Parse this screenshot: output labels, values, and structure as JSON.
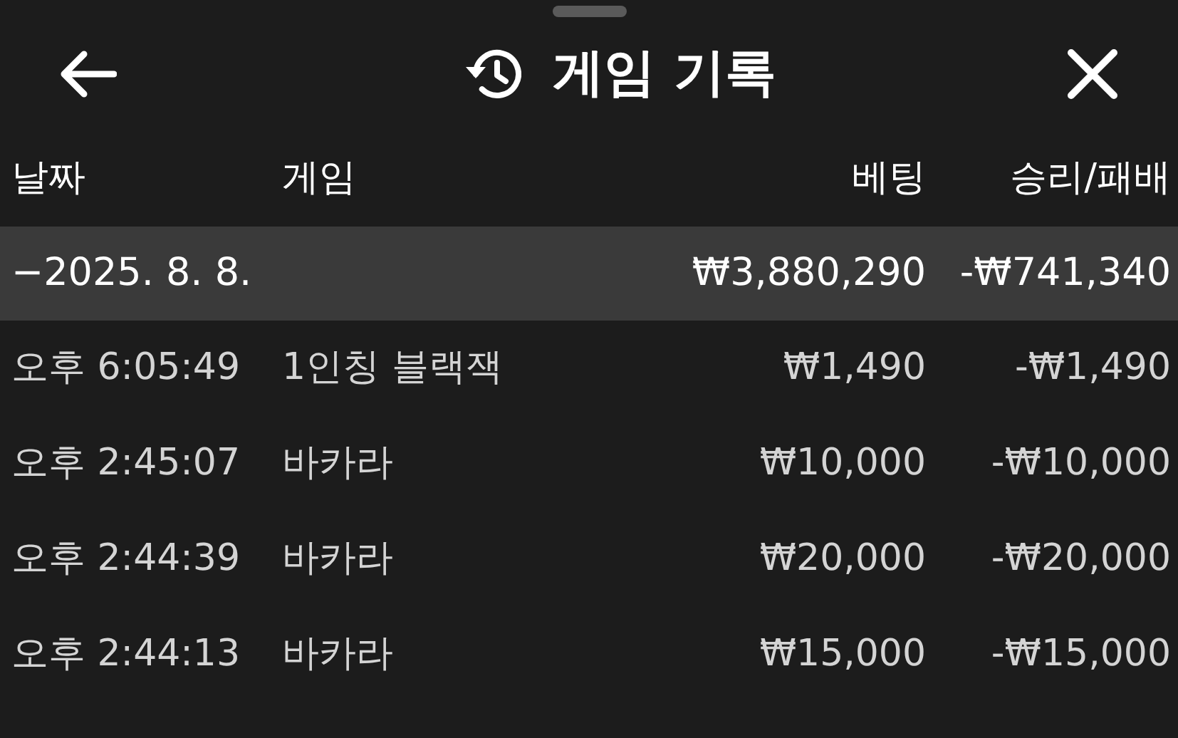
{
  "header": {
    "title": "게임 기록"
  },
  "table": {
    "columns": [
      "날짜",
      "게임",
      "베팅",
      "승리/패배"
    ],
    "group": {
      "date": "−2025. 8. 8.",
      "bet": "₩3,880,290",
      "result": "-₩741,340"
    },
    "rows": [
      {
        "time": "오후 6:05:49",
        "game": "1인칭 블랙잭",
        "bet": "₩1,490",
        "result": "-₩1,490"
      },
      {
        "time": "오후 2:45:07",
        "game": "바카라",
        "bet": "₩10,000",
        "result": "-₩10,000"
      },
      {
        "time": "오후 2:44:39",
        "game": "바카라",
        "bet": "₩20,000",
        "result": "-₩20,000"
      },
      {
        "time": "오후 2:44:13",
        "game": "바카라",
        "bet": "₩15,000",
        "result": "-₩15,000"
      }
    ]
  }
}
